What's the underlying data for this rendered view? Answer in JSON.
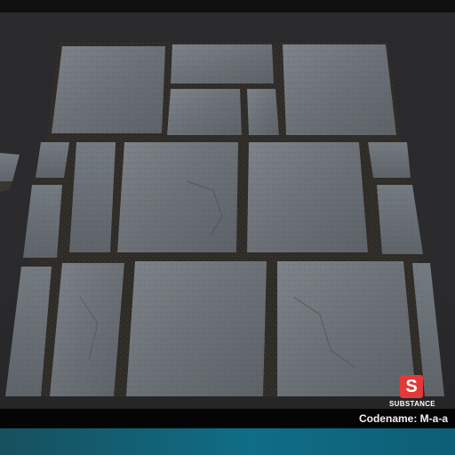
{
  "caption": {
    "codename_text": "Codename: M-a-a"
  },
  "logo": {
    "mark": "S",
    "wordmark": "SUBSTANCE",
    "subtext": "",
    "color": "#e23a3a"
  },
  "scene": {
    "subject": "stone-floor-tiles",
    "background_color": "#2a2a2c",
    "stone_color": "#6b7177",
    "grout_color": "#2e2a26",
    "accent_strip_color": "#0f6d86"
  }
}
